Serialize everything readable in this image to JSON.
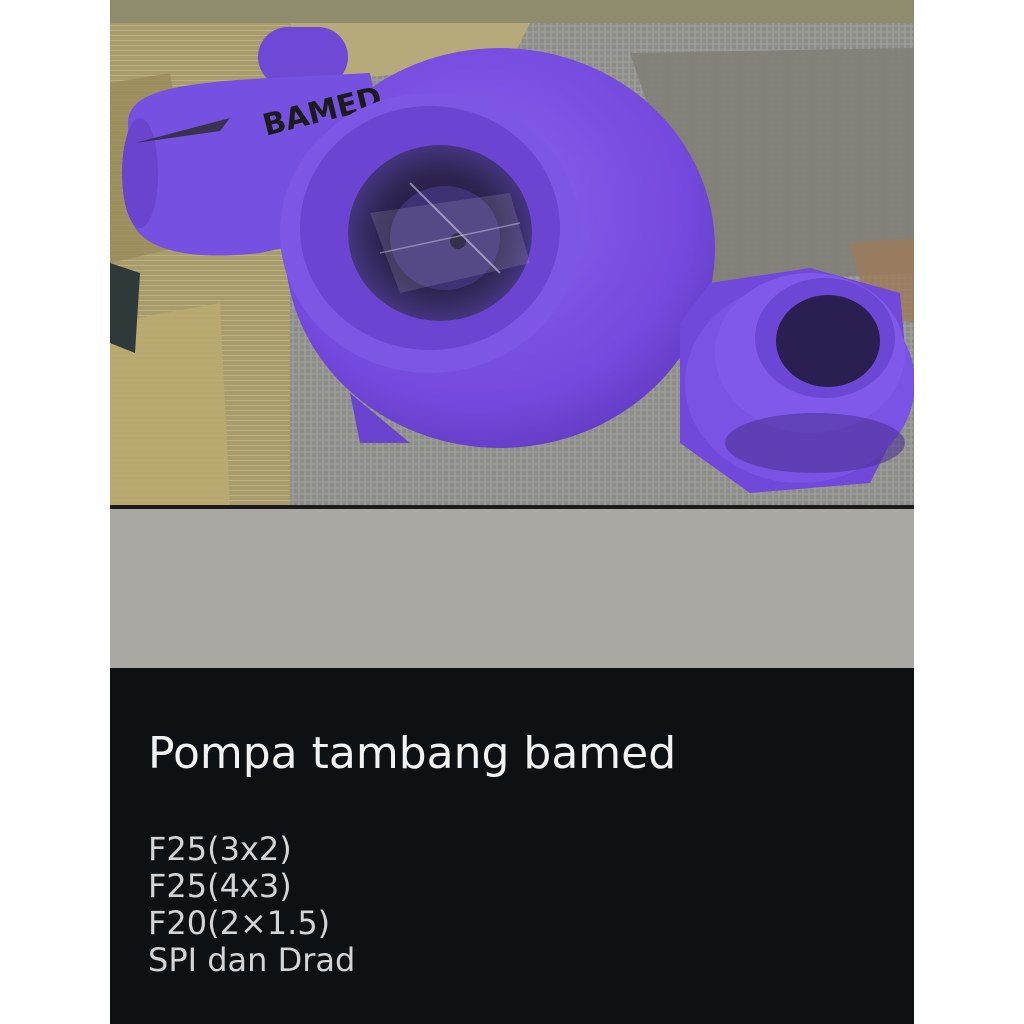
{
  "photo": {
    "casting_mark": "BAMED",
    "colors": {
      "pump_body": "#7b52e6",
      "pump_shadow": "#5b36b8",
      "tarp": "#8e8e8a",
      "sack": "#a89c6c",
      "top_strip": "#8f8c6e",
      "gray_band": "#a9a8a3",
      "caption_background": "#0d1114"
    }
  },
  "post": {
    "title": "Pompa tambang bamed",
    "specs": [
      "F25(3x2)",
      "F25(4x3)",
      "F20(2×1.5)",
      "SPI dan Drad"
    ]
  }
}
